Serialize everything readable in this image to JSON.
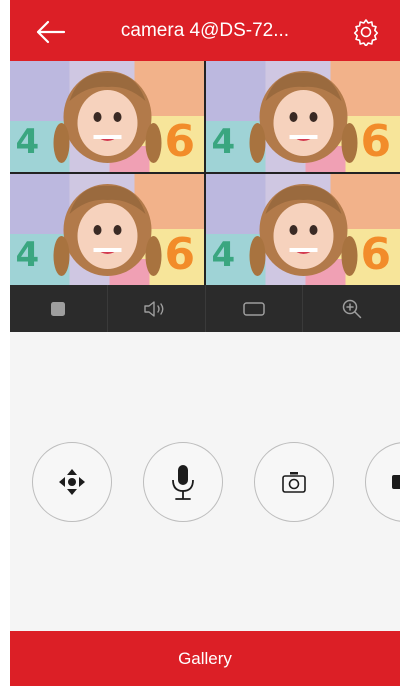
{
  "header": {
    "title": "camera 4@DS-72...",
    "back_icon": "arrow-left-icon",
    "settings_icon": "gear-icon"
  },
  "video": {
    "tiles": [
      {
        "icon": "camera-feed"
      },
      {
        "icon": "camera-feed"
      },
      {
        "icon": "camera-feed"
      },
      {
        "icon": "camera-feed"
      }
    ]
  },
  "toolbar": {
    "items": [
      {
        "icon": "stop-icon"
      },
      {
        "icon": "speaker-icon"
      },
      {
        "icon": "aspect-ratio-icon"
      },
      {
        "icon": "zoom-in-icon"
      }
    ]
  },
  "controls": {
    "buttons": [
      {
        "icon": "ptz-direction-icon"
      },
      {
        "icon": "microphone-icon"
      },
      {
        "icon": "camera-capture-icon"
      },
      {
        "icon": "record-icon"
      }
    ]
  },
  "gallery": {
    "label": "Gallery"
  },
  "colors": {
    "brand_red": "#dc1f26",
    "toolbar_bg": "#2b2b2b",
    "panel_bg": "#f5f5f5"
  }
}
